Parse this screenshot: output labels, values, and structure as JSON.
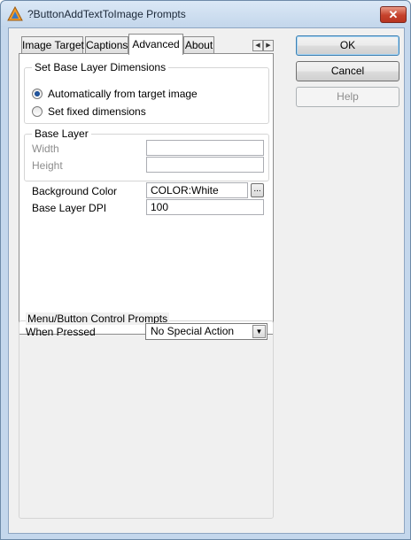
{
  "window": {
    "title": "?ButtonAddTextToImage Prompts",
    "close_glyph": "✕"
  },
  "tabs": [
    {
      "label": "Image Target",
      "active": false
    },
    {
      "label": "Captions",
      "active": false
    },
    {
      "label": "Advanced",
      "active": true
    },
    {
      "label": "About",
      "active": false
    }
  ],
  "tab_scroll": {
    "left_glyph": "◀",
    "right_glyph": "▶"
  },
  "base_layer_dimensions": {
    "group_label": "Set Base Layer Dimensions",
    "options": [
      {
        "label": "Automatically from target image",
        "checked": true
      },
      {
        "label": "Set fixed dimensions",
        "checked": false
      }
    ]
  },
  "base_layer": {
    "group_label": "Base Layer",
    "width_label": "Width",
    "width_value": "",
    "height_label": "Height",
    "height_value": ""
  },
  "background_color": {
    "label": "Background Color",
    "value": "COLOR:White",
    "browse_label": "..."
  },
  "base_layer_dpi": {
    "label": "Base Layer DPI",
    "value": "100"
  },
  "menu_button_prompts": {
    "group_label": "Menu/Button Control Prompts",
    "when_pressed_label": "When Pressed",
    "when_pressed_value": "No Special Action",
    "dropdown_glyph": "▼"
  },
  "buttons": {
    "ok": "OK",
    "cancel": "Cancel",
    "help": "Help"
  },
  "colors": {
    "title_bar": "#c3d6eb",
    "close_button": "#c5412b",
    "dialog_background": "#f0f0f0",
    "radio_selected": "#0b3e86"
  },
  "icons": [
    "app-triangle-icon",
    "close-icon",
    "tab-scroll-left-icon",
    "tab-scroll-right-icon",
    "dropdown-arrow-icon"
  ]
}
